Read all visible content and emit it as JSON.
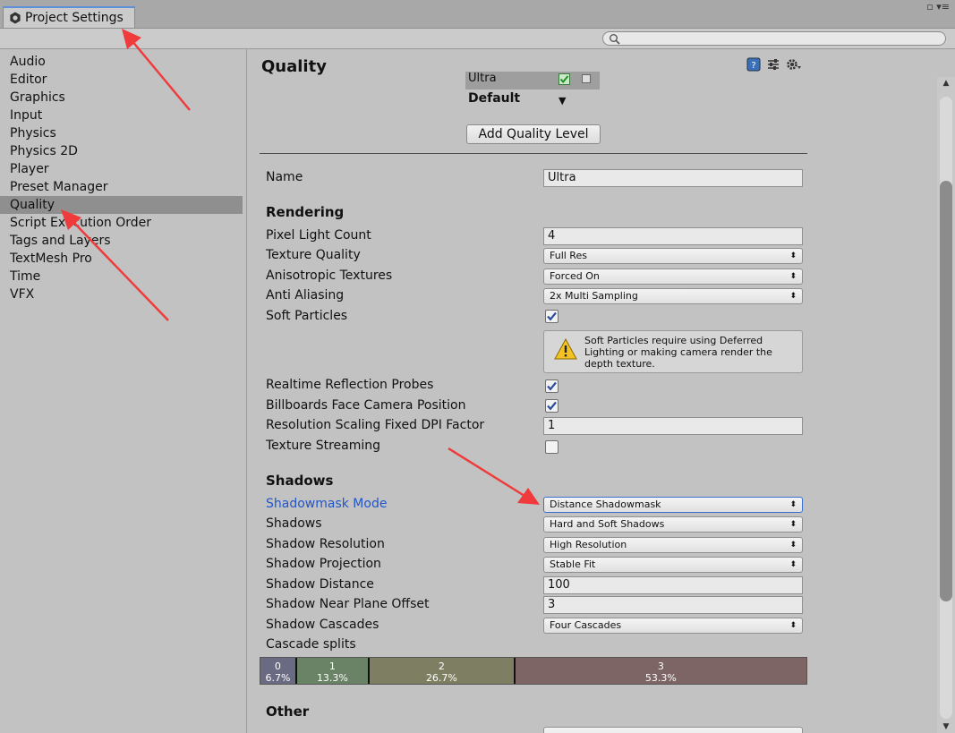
{
  "window": {
    "tab_title": "Project Settings",
    "control_glyphs": "▫ ▾≡"
  },
  "search": {
    "placeholder": "",
    "value": ""
  },
  "sidebar": {
    "items": [
      {
        "label": "Audio"
      },
      {
        "label": "Editor"
      },
      {
        "label": "Graphics"
      },
      {
        "label": "Input"
      },
      {
        "label": "Physics"
      },
      {
        "label": "Physics 2D"
      },
      {
        "label": "Player"
      },
      {
        "label": "Preset Manager"
      },
      {
        "label": "Quality",
        "selected": true
      },
      {
        "label": "Script Execution Order"
      },
      {
        "label": "Tags and Layers"
      },
      {
        "label": "TextMesh Pro"
      },
      {
        "label": "Time"
      },
      {
        "label": "VFX"
      }
    ]
  },
  "main": {
    "title": "Quality",
    "header_icons": [
      "help-book-icon",
      "preset-sliders-icon",
      "settings-gear-icon"
    ],
    "levels": {
      "current_level": "Ultra",
      "default_label": "Default",
      "add_button": "Add Quality Level"
    },
    "name": {
      "label": "Name",
      "value": "Ultra"
    },
    "rendering": {
      "header": "Rendering",
      "pixel_light_count": {
        "label": "Pixel Light Count",
        "value": "4"
      },
      "texture_quality": {
        "label": "Texture Quality",
        "value": "Full Res"
      },
      "anisotropic": {
        "label": "Anisotropic Textures",
        "value": "Forced On"
      },
      "anti_aliasing": {
        "label": "Anti Aliasing",
        "value": "2x Multi Sampling"
      },
      "soft_particles": {
        "label": "Soft Particles",
        "checked": true
      },
      "warning": "Soft Particles require using Deferred Lighting or making camera render the depth texture.",
      "realtime_reflection": {
        "label": "Realtime Reflection Probes",
        "checked": true
      },
      "billboards": {
        "label": "Billboards Face Camera Position",
        "checked": true
      },
      "dpi_factor": {
        "label": "Resolution Scaling Fixed DPI Factor",
        "value": "1"
      },
      "texture_streaming": {
        "label": "Texture Streaming",
        "checked": false
      }
    },
    "shadows": {
      "header": "Shadows",
      "shadowmask_mode": {
        "label": "Shadowmask Mode",
        "value": "Distance Shadowmask"
      },
      "shadows": {
        "label": "Shadows",
        "value": "Hard and Soft Shadows"
      },
      "resolution": {
        "label": "Shadow Resolution",
        "value": "High Resolution"
      },
      "projection": {
        "label": "Shadow Projection",
        "value": "Stable Fit"
      },
      "distance": {
        "label": "Shadow Distance",
        "value": "100"
      },
      "near_plane": {
        "label": "Shadow Near Plane Offset",
        "value": "3"
      },
      "cascades": {
        "label": "Shadow Cascades",
        "value": "Four Cascades"
      },
      "cascade_splits_label": "Cascade splits",
      "cascade_splits": [
        {
          "index": "0",
          "percent": "6.7%",
          "fraction": 0.067,
          "color": "#6a6a82"
        },
        {
          "index": "1",
          "percent": "13.3%",
          "fraction": 0.133,
          "color": "#6a8366"
        },
        {
          "index": "2",
          "percent": "26.7%",
          "fraction": 0.267,
          "color": "#7e7f62"
        },
        {
          "index": "3",
          "percent": "53.3%",
          "fraction": 0.533,
          "color": "#7e6565"
        }
      ]
    },
    "other": {
      "header": "Other"
    }
  },
  "colors": {
    "annotation_arrow": "#ef3b3b",
    "link_label": "#2155c9",
    "selected_item": "#8f8f8f",
    "check_mark": "#2a4e9c"
  }
}
